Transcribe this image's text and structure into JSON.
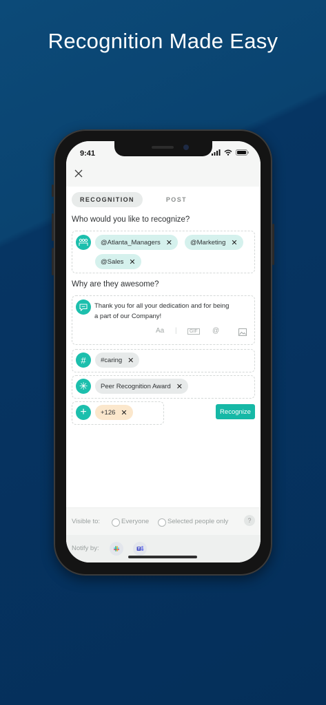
{
  "headline": "Recognition Made Easy",
  "status": {
    "time": "9:41"
  },
  "tabs": {
    "active": "RECOGNITION",
    "other": "POST"
  },
  "recipients": {
    "question": "Who would you like to recognize?",
    "chips": [
      "@Atlanta_Managers",
      "@Marketing",
      "@Sales"
    ]
  },
  "reason": {
    "question": "Why are they awesome?",
    "message_line1": "Thank you for all your dedication and for being",
    "message_line2": "a part of our Company!",
    "tools": {
      "text": "Aa",
      "gif": "GIF",
      "mention": "@"
    }
  },
  "hashtag": {
    "chip": "#caring"
  },
  "award": {
    "chip": "Peer Recognition Award"
  },
  "points": {
    "chip": "+126"
  },
  "recognize_label": "Recognize",
  "visibility": {
    "label": "Visible to:",
    "opt1": "Everyone",
    "opt2": "Selected people only",
    "help": "?"
  },
  "notify": {
    "label": "Notify by:"
  },
  "colors": {
    "accent": "#1cbfad",
    "background": "#073a63"
  }
}
